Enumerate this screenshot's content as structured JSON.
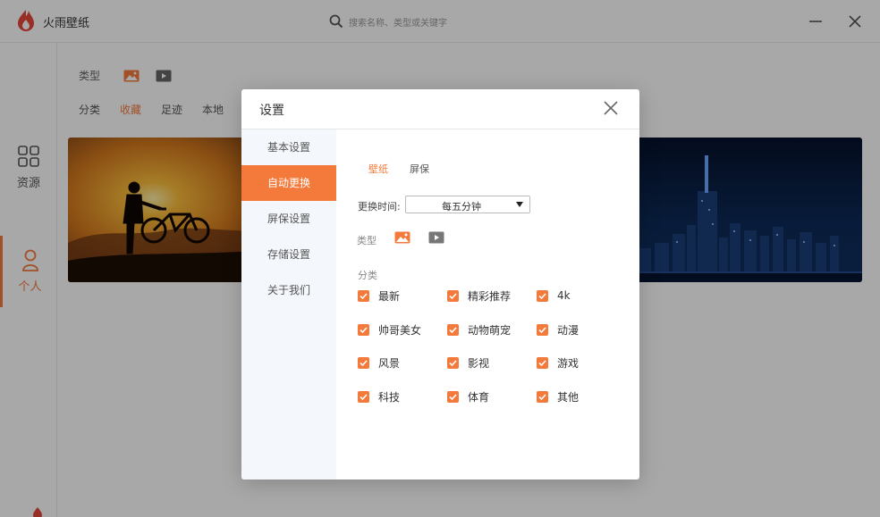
{
  "app": {
    "title": "火雨壁纸",
    "search_placeholder": "搜索名称、类型或关键字"
  },
  "nav": [
    {
      "label": "资源"
    },
    {
      "label": "个人"
    }
  ],
  "main": {
    "type_label": "类型",
    "tabs": [
      "分类",
      "收藏",
      "足迹",
      "本地"
    ],
    "active_tab": "收藏"
  },
  "dialog": {
    "title": "设置",
    "side_items": [
      "基本设置",
      "自动更换",
      "屏保设置",
      "存储设置",
      "关于我们"
    ],
    "active_side": "自动更换",
    "sub_tabs": [
      "壁纸",
      "屏保"
    ],
    "active_sub_tab": "壁纸",
    "interval_label": "更换时间:",
    "interval_value": "每五分钟",
    "type_label": "类型",
    "category_label": "分类",
    "categories": [
      "最新",
      "精彩推荐",
      "4k",
      "帅哥美女",
      "动物萌宠",
      "动漫",
      "风景",
      "影视",
      "游戏",
      "科技",
      "体育",
      "其他"
    ],
    "all_checked": true
  },
  "colors": {
    "accent": "#f47a3c"
  }
}
